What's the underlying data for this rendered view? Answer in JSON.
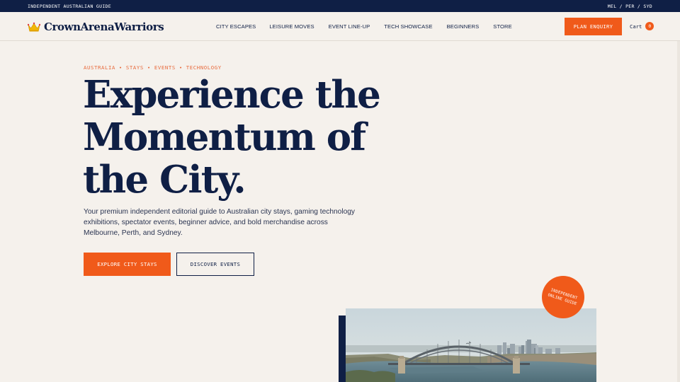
{
  "topbar": {
    "left_text": "INDEPENDENT AUSTRALIAN GUIDE",
    "right_text": "MEL / PER / SYD"
  },
  "header": {
    "logo_icon": "crown-icon",
    "logo_text": "CrownArenaWarriors",
    "nav": [
      "CITY ESCAPES",
      "LEISURE MOVES",
      "EVENT LINE-UP",
      "TECH SHOWCASE",
      "BEGINNERS",
      "STORE"
    ],
    "cta_label": "PLAN ENQUIRY",
    "cart_label": "Cart",
    "cart_count": "0"
  },
  "hero": {
    "eyebrow": "AUSTRALIA • STAYS • EVENTS • TECHNOLOGY",
    "headline_lines": [
      "Experience the",
      "Momentum of",
      "the City."
    ],
    "lede": "Your premium independent editorial guide to Australian city stays, gaming technology exhibitions, spectator events, beginner advice, and bold merchandise across Melbourne, Perth, and Sydney.",
    "primary_button": "EXPLORE CITY STAYS",
    "secondary_button": "DISCOVER EVENTS",
    "badge_text": "INDEPENDENT ONLINE GUIDE",
    "image_subject": "sydney-harbour-bridge-photo"
  },
  "colors": {
    "navy": "#0f1f45",
    "accent": "#f05a1a",
    "background": "#f5f1ec"
  }
}
